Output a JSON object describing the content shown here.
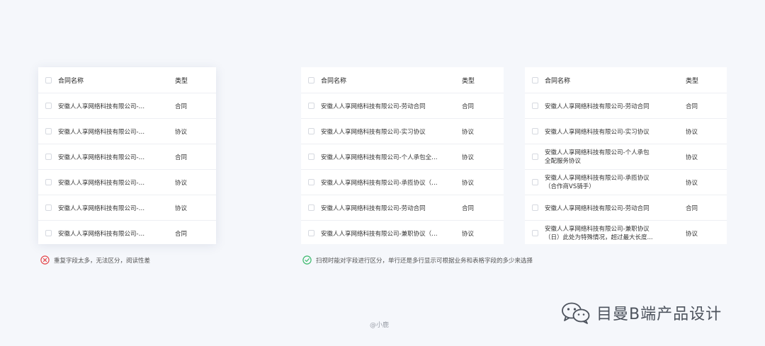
{
  "tables": [
    {
      "headers": {
        "name": "合同名称",
        "type": "类型"
      },
      "rows": [
        {
          "name": "安徽人人享网络科技有限公司-劳动合同",
          "type": "合同"
        },
        {
          "name": "安徽人人享网络科技有限公司-实习协议",
          "type": "协议"
        },
        {
          "name": "安徽人人享网络科技有限公司-个人承包全配服务协议",
          "type": "合同"
        },
        {
          "name": "安徽人人享网络科技有限公司-承揽协议",
          "type": "协议"
        },
        {
          "name": "安徽人人享网络科技有限公司-劳动合同",
          "type": "协议"
        },
        {
          "name": "安徽人人享网络科技有限公司-兼职协议",
          "type": "合同"
        }
      ]
    },
    {
      "headers": {
        "name": "合同名称",
        "type": "类型"
      },
      "rows": [
        {
          "name": "安徽人人享网络科技有限公司-劳动合同",
          "type": "合同"
        },
        {
          "name": "安徽人人享网络科技有限公司-实习协议",
          "type": "协议"
        },
        {
          "name": "安徽人人享网络科技有限公司-个人承包全配服务协议",
          "type": "协议"
        },
        {
          "name": "安徽人人享网络科技有限公司-承揽协议（合作商VS骑手）",
          "type": "协议"
        },
        {
          "name": "安徽人人享网络科技有限公司-劳动合同",
          "type": "合同"
        },
        {
          "name": "安徽人人享网络科技有限公司-兼职协议（日）此处为特殊情况，超过最大长度",
          "type": "协议"
        }
      ]
    },
    {
      "headers": {
        "name": "合同名称",
        "type": "类型"
      },
      "rows": [
        {
          "name": "安徽人人享网络科技有限公司-劳动合同",
          "type": "合同"
        },
        {
          "name": "安徽人人享网络科技有限公司-实习协议",
          "type": "协议"
        },
        {
          "name": "安徽人人享网络科技有限公司-个人承包",
          "name2": "全配服务协议",
          "type": "协议"
        },
        {
          "name": "安徽人人享网络科技有限公司-承揽协议",
          "name2": "（合作商VS骑手）",
          "type": "协议"
        },
        {
          "name": "安徽人人享网络科技有限公司-劳动合同",
          "type": "合同"
        },
        {
          "name": "安徽人人享网络科技有限公司-兼职协议",
          "name2": "（日）此处为特殊情况，超过最大长度...",
          "type": "协议"
        }
      ]
    }
  ],
  "notes": {
    "bad": "重复字段太多，无法区分，阅读性差",
    "good": "扫视时能对字段进行区分，单行还是多行显示可根据业务和表格字段的多少来选择"
  },
  "credit": "@小鹿",
  "brand": "目曼B端产品设计",
  "colors": {
    "bad": "#e5484d",
    "good": "#3cba6d"
  }
}
